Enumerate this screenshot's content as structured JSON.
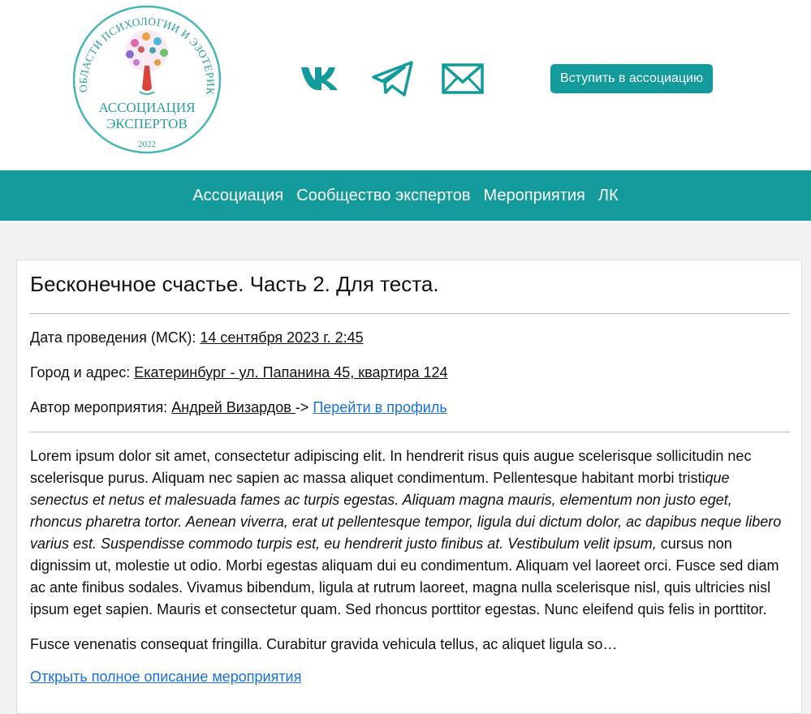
{
  "header": {
    "logo": {
      "arc_text": "В ОБЛАСТИ ПСИХОЛОГИИ И ЭЗОТЕРИКИ",
      "name_line1": "АССОЦИАЦИЯ",
      "name_line2": "ЭКСПЕРТОВ",
      "year": "2022"
    },
    "social_icons": [
      "vk-icon",
      "telegram-icon",
      "mail-icon"
    ],
    "join_button": "Вступить в ассоциацию"
  },
  "nav": {
    "items": [
      "Ассоциация",
      "Сообщество экспертов",
      "Мероприятия",
      "ЛК"
    ]
  },
  "event": {
    "title": "Бесконечное счастье. Часть 2. Для теста.",
    "date_label": "Дата проведения (МСК): ",
    "date_value": "14 сентября 2023 г. 2:45",
    "address_label": "Город и адрес: ",
    "address_value": "Екатеринбург - ул. Папанина 45, квартира 124",
    "author_label": "Автор мероприятия: ",
    "author_name": "Андрей Визардов ",
    "author_arrow": "->",
    "author_profile_link": "Перейти в профиль",
    "description": {
      "p1_normal_start": "Lorem ipsum dolor sit amet, consectetur adipiscing elit. In hendrerit risus quis augue scelerisque sollicitudin nec scelerisque purus. Aliquam nec sapien ac massa aliquet condimentum. Pellentesque habitant morbi tristi",
      "p1_italic": "que senectus et netus et malesuada fames ac turpis egestas. Aliquam magna mauris, elementum non justo eget, rhoncus pharetra tortor. Aenean viverra, erat ut pellentesque tempor, ligula dui dictum dolor, ac dapibus neque libero varius est. Suspendisse commodo turpis est, eu hendrerit justo finibus at. Vestibulum velit ipsum,",
      "p1_normal_end": " cursus non dignissim ut, molestie ut odio. Morbi egestas aliquam dui eu condimentum. Aliquam vel laoreet orci. Fusce sed diam ac ante finibus sodales. Vivamus bibendum, ligula at rutrum laoreet, magna nulla scelerisque nisl, quis ultricies nisl ipsum eget sapien. Mauris et consectetur quam. Sed rhoncus porttitor egestas. Nunc eleifend quis felis in porttitor.",
      "p2": "Fusce venenatis consequat fringilla. Curabitur gravida vehicula tellus, ac aliquet ligula so…"
    },
    "open_full_link": "Открыть полное описание мероприятия"
  },
  "colors": {
    "accent": "#139a9b",
    "link": "#1a6fdf",
    "page_bg": "#f2f2f2"
  }
}
